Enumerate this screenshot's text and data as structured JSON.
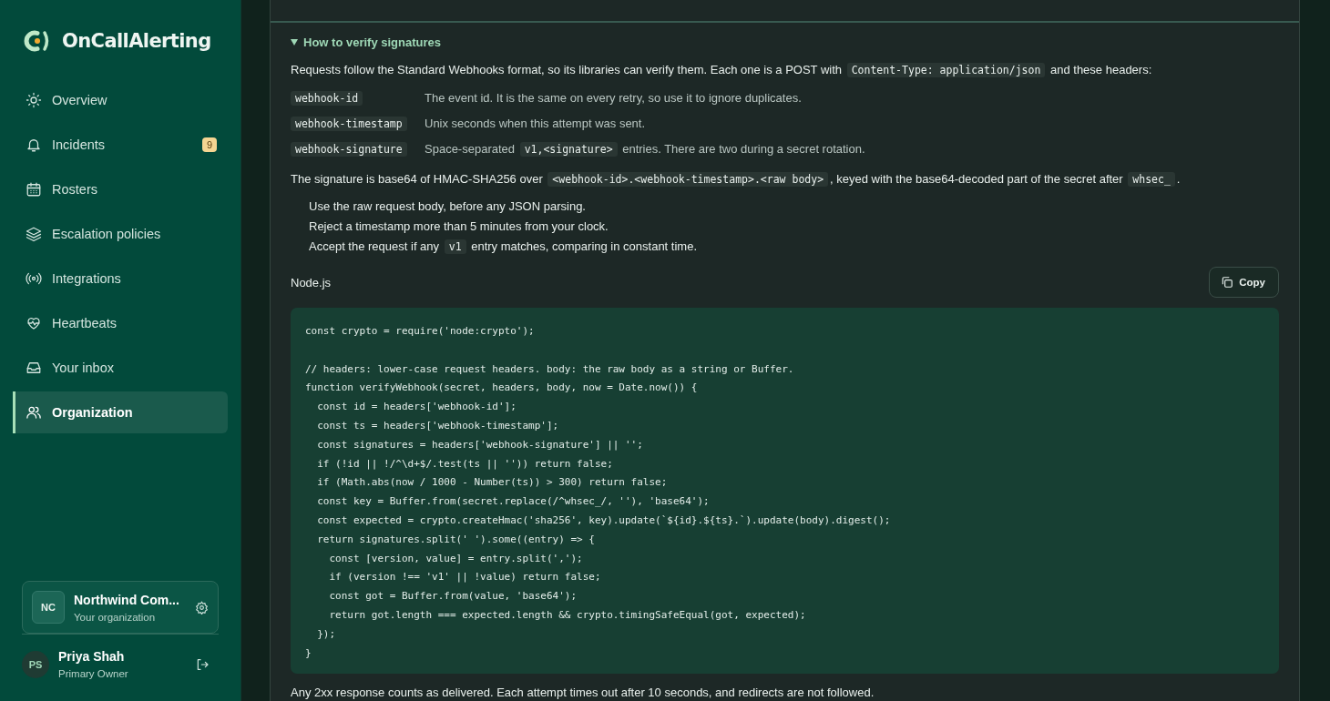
{
  "brand": {
    "name": "OnCallAlerting"
  },
  "nav": [
    {
      "label": "Overview",
      "selected": false
    },
    {
      "label": "Incidents",
      "selected": false,
      "badge": "9"
    },
    {
      "label": "Rosters",
      "selected": false
    },
    {
      "label": "Escalation policies",
      "selected": false
    },
    {
      "label": "Integrations",
      "selected": false
    },
    {
      "label": "Heartbeats",
      "selected": false
    },
    {
      "label": "Your inbox",
      "selected": false
    },
    {
      "label": "Organization",
      "selected": true
    }
  ],
  "organization": {
    "initials": "NC",
    "name": "Northwind Com...",
    "subtitle": "Your organization"
  },
  "user": {
    "initials": "PS",
    "name": "Priya Shah",
    "role": "Primary Owner"
  },
  "section": {
    "title": "How to verify signatures",
    "expanded": true,
    "intro": [
      {
        "kind": "text",
        "text": "Requests follow the Standard Webhooks format, so its libraries can verify them. Each one is a POST with "
      },
      {
        "kind": "code",
        "text": "Content-Type: application/json"
      },
      {
        "kind": "text",
        "text": " and these headers:"
      }
    ],
    "headers": [
      {
        "name": "webhook-id",
        "description": [
          {
            "kind": "text",
            "text": "The event id. It is the same on every retry, so use it to ignore duplicates."
          }
        ]
      },
      {
        "name": "webhook-timestamp",
        "description": [
          {
            "kind": "text",
            "text": "Unix seconds when this attempt was sent."
          }
        ]
      },
      {
        "name": "webhook-signature",
        "description": [
          {
            "kind": "text",
            "text": "Space-separated "
          },
          {
            "kind": "code",
            "text": "v1,<signature>"
          },
          {
            "kind": "text",
            "text": " entries. There are two during a secret rotation."
          }
        ]
      }
    ],
    "signature_note": [
      {
        "kind": "text",
        "text": "The signature is base64 of HMAC-SHA256 over "
      },
      {
        "kind": "code",
        "text": "<webhook-id>.<webhook-timestamp>.<raw body>"
      },
      {
        "kind": "text",
        "text": ", keyed with the base64-decoded part of the secret after "
      },
      {
        "kind": "code",
        "text": "whsec_"
      },
      {
        "kind": "text",
        "text": "."
      }
    ],
    "rules": [
      [
        {
          "kind": "text",
          "text": "Use the raw request body, before any JSON parsing."
        }
      ],
      [
        {
          "kind": "text",
          "text": "Reject a timestamp more than 5 minutes from your clock."
        }
      ],
      [
        {
          "kind": "text",
          "text": "Accept the request if any "
        },
        {
          "kind": "code",
          "text": "v1"
        },
        {
          "kind": "text",
          "text": " entry matches, comparing in constant time."
        }
      ]
    ],
    "code_label": "Node.js",
    "copy_button": "Copy",
    "code": "const crypto = require('node:crypto');\n\n// headers: lower-case request headers. body: the raw body as a string or Buffer.\nfunction verifyWebhook(secret, headers, body, now = Date.now()) {\n  const id = headers['webhook-id'];\n  const ts = headers['webhook-timestamp'];\n  const signatures = headers['webhook-signature'] || '';\n  if (!id || !/^\\d+$/.test(ts || '')) return false;\n  if (Math.abs(now / 1000 - Number(ts)) > 300) return false;\n  const key = Buffer.from(secret.replace(/^whsec_/, ''), 'base64');\n  const expected = crypto.createHmac('sha256', key).update(`${id}.${ts}.`).update(body).digest();\n  return signatures.split(' ').some((entry) => {\n    const [version, value] = entry.split(',');\n    if (version !== 'v1' || !value) return false;\n    const got = Buffer.from(value, 'base64');\n    return got.length === expected.length && crypto.timingSafeEqual(got, expected);\n  });\n}",
    "footer": "Any 2xx response counts as delivered. Each attempt times out after 10 seconds, and redirects are not followed."
  }
}
